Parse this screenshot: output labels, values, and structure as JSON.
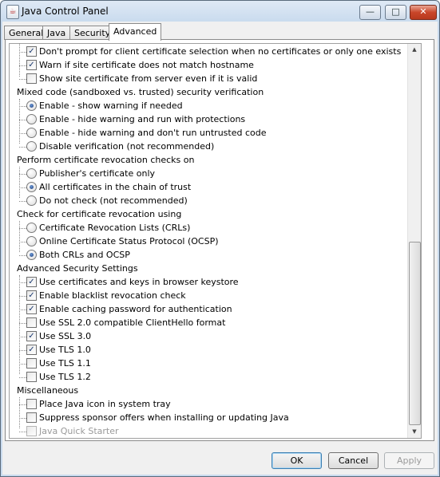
{
  "window": {
    "title": "Java Control Panel",
    "icon": "java-icon"
  },
  "title_buttons": {
    "minimize": "—",
    "maximize": "□",
    "close": "✕"
  },
  "tabs": [
    {
      "label": "General"
    },
    {
      "label": "Java"
    },
    {
      "label": "Security"
    },
    {
      "label": "Advanced",
      "active": true
    }
  ],
  "settings": {
    "cert_items": [
      {
        "label": "Don't prompt for client certificate selection when no certificates or only one exists",
        "checked": true
      },
      {
        "label": "Warn if site certificate does not match hostname",
        "checked": true
      },
      {
        "label": "Show site certificate from server even if it is valid",
        "checked": false
      }
    ],
    "mixed_code": {
      "label": "Mixed code (sandboxed vs. trusted) security verification",
      "options": [
        {
          "label": "Enable - show warning if needed",
          "selected": true
        },
        {
          "label": "Enable - hide warning and run with protections",
          "selected": false
        },
        {
          "label": "Enable - hide warning and don't run untrusted code",
          "selected": false
        },
        {
          "label": "Disable verification (not recommended)",
          "selected": false
        }
      ]
    },
    "revocation_checks": {
      "label": "Perform certificate revocation checks on",
      "options": [
        {
          "label": "Publisher's certificate only",
          "selected": false
        },
        {
          "label": "All certificates in the chain of trust",
          "selected": true
        },
        {
          "label": "Do not check (not recommended)",
          "selected": false
        }
      ]
    },
    "revocation_using": {
      "label": "Check for certificate revocation using",
      "options": [
        {
          "label": "Certificate Revocation Lists (CRLs)",
          "selected": false
        },
        {
          "label": "Online Certificate Status Protocol (OCSP)",
          "selected": false
        },
        {
          "label": "Both CRLs and OCSP",
          "selected": true
        }
      ]
    },
    "advanced_security": {
      "label": "Advanced Security Settings",
      "items": [
        {
          "label": "Use certificates and keys in browser keystore",
          "checked": true
        },
        {
          "label": "Enable blacklist revocation check",
          "checked": true
        },
        {
          "label": "Enable caching password for authentication",
          "checked": true
        },
        {
          "label": "Use SSL 2.0 compatible ClientHello format",
          "checked": false
        },
        {
          "label": "Use SSL 3.0",
          "checked": true
        },
        {
          "label": "Use TLS 1.0",
          "checked": true
        },
        {
          "label": "Use TLS 1.1",
          "checked": false
        },
        {
          "label": "Use TLS 1.2",
          "checked": false
        }
      ]
    },
    "misc": {
      "label": "Miscellaneous",
      "items": [
        {
          "label": "Place Java icon in system tray",
          "checked": false
        },
        {
          "label": "Suppress sponsor offers when installing or updating Java",
          "checked": false
        },
        {
          "label": "Java Quick Starter",
          "checked": false,
          "disabled": true
        }
      ]
    }
  },
  "scrollbar": {
    "up": "▲",
    "down": "▼"
  },
  "check_mark": "✓",
  "buttons": {
    "ok": "OK",
    "cancel": "Cancel",
    "apply": "Apply"
  }
}
